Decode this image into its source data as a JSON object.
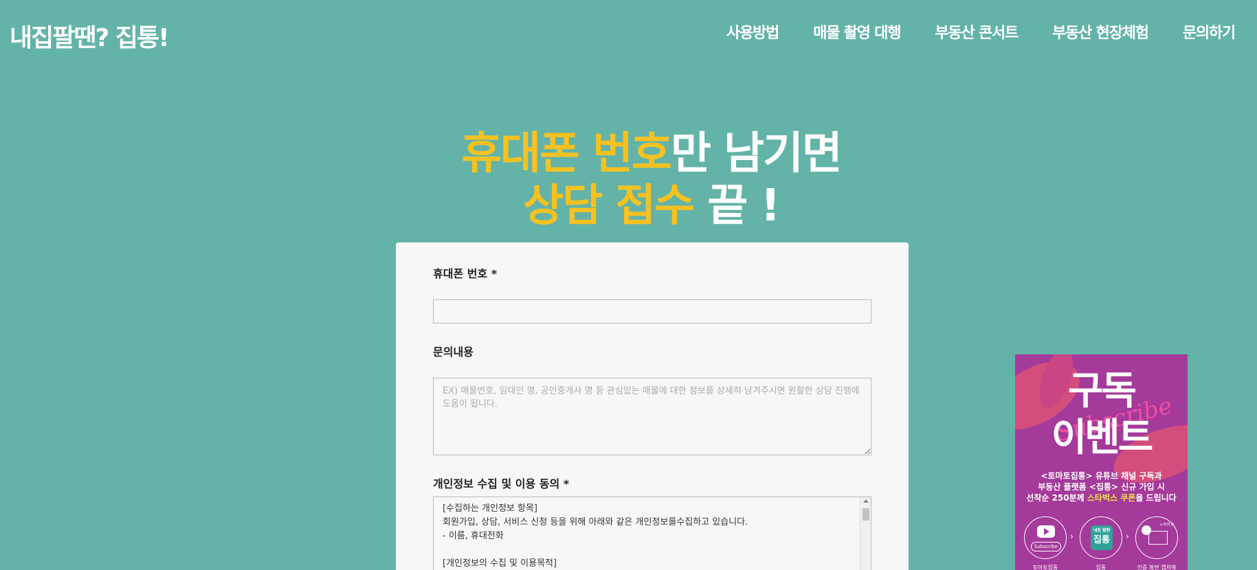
{
  "header": {
    "logo": "내집팔땐? 집통!",
    "nav": [
      "사용방법",
      "매물 촬영 대행",
      "부동산 콘서트",
      "부동산 현장체험",
      "문의하기"
    ]
  },
  "headline": {
    "line1_yellow": "휴대폰 번호",
    "line1_white": "만 남기면",
    "line2_yellow": "상담 접수",
    "line2_white": " 끝 !"
  },
  "form": {
    "phone_label": "휴대폰 번호 *",
    "phone_value": "",
    "inquiry_label": "문의내용",
    "inquiry_placeholder": "EX) 매물번호, 임대인 명, 공인중개사 명 등 관심있는 매물에 대한 정보를 상세히 남겨주시면 원활한 상담 진행에 도움이 됩니다.",
    "privacy_label": "개인정보 수집 및 이용 동의 *",
    "privacy_lines": [
      "[수집하는 개인정보 항목]",
      "회원가입, 상담, 서비스 신청 등을 위해 아래와 같은 개인정보를수집하고 있습니다.",
      "- 이름, 휴대전화",
      "",
      "[개인정보의 수집 및 이용목적]"
    ]
  },
  "ad": {
    "title1": "구독",
    "subscribe_script": "Subscribe",
    "title2": "이벤트",
    "desc1": "<토마토집통> 유튜브 채널 구독과",
    "desc2": "부동산 플랫폼 <집통> 신규 가입 시",
    "desc3_pre": "선착순 250분께 ",
    "desc3_hl": "스타벅스 쿠폰",
    "desc3_post": "을 드립니다",
    "subscribe_btn": "Subscribe",
    "app_name": "집통",
    "app_sub": "내집 팔땐",
    "mail_note": "+카카오",
    "cap1": "토마토집통",
    "cap2": "집통",
    "cap3": "인증 화면 캡처해서"
  },
  "colors": {
    "background": "#64b3a8",
    "accent_yellow": "#f6c222",
    "ad_purple": "#a43a9a"
  }
}
